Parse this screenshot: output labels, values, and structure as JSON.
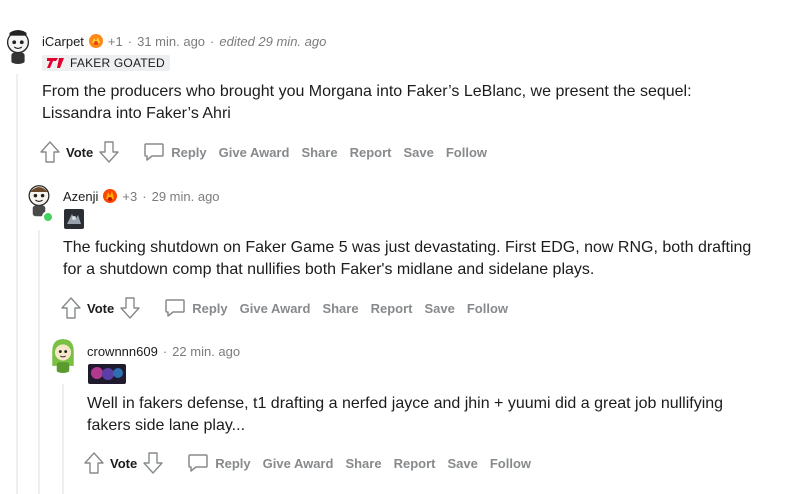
{
  "colors": {
    "flair_bg": "#edeff1",
    "meta_gray": "#7c7c7c",
    "action_gray": "#878a8c",
    "thread_line": "#edeff1",
    "online_green": "#46d160"
  },
  "comments": [
    {
      "username": "iCarpet",
      "award_count": "+1",
      "time": "31 min. ago",
      "edited": "edited 29 min. ago",
      "flair_text": "FAKER GOATED",
      "body": [
        "From the producers who brought you Morgana into Faker’s LeBlanc, we present the sequel:",
        "Lissandra into Faker’s Ahri"
      ],
      "actions": {
        "vote": "Vote",
        "reply": "Reply",
        "give_award": "Give Award",
        "share": "Share",
        "report": "Report",
        "save": "Save",
        "follow": "Follow"
      }
    },
    {
      "username": "Azenji",
      "award_count": "+3",
      "time": "29 min. ago",
      "body": [
        "The fucking shutdown on Faker Game 5 was just devastating. First EDG, now RNG, both drafting",
        "for a shutdown comp that nullifies both Faker's midlane and sidelane plays."
      ],
      "actions": {
        "vote": "Vote",
        "reply": "Reply",
        "give_award": "Give Award",
        "share": "Share",
        "report": "Report",
        "save": "Save",
        "follow": "Follow"
      }
    },
    {
      "username": "crownnn609",
      "time": "22 min. ago",
      "body": [
        "Well in fakers defense, t1 drafting a nerfed jayce and jhin + yuumi did a great job nullifying",
        "fakers side lane play..."
      ],
      "actions": {
        "vote": "Vote",
        "reply": "Reply",
        "give_award": "Give Award",
        "share": "Share",
        "report": "Report",
        "save": "Save",
        "follow": "Follow"
      }
    }
  ]
}
